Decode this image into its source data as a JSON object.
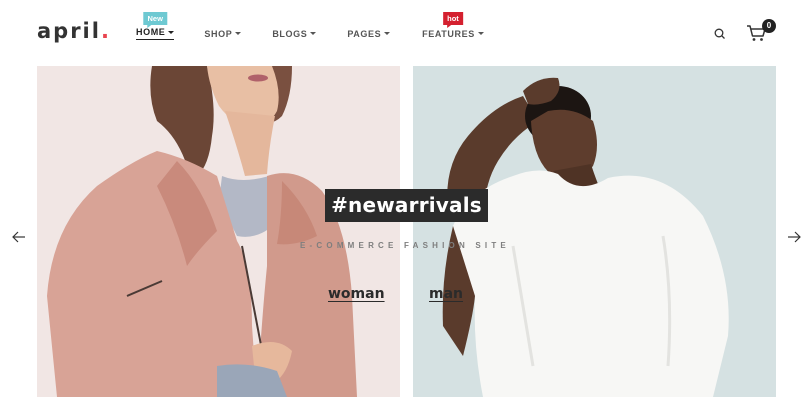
{
  "brand": {
    "name": "april",
    "dot": "."
  },
  "nav": {
    "items": [
      {
        "label": "HOME",
        "badge": "New"
      },
      {
        "label": "SHOP"
      },
      {
        "label": "BLOGS"
      },
      {
        "label": "PAGES"
      },
      {
        "label": "FEATURES",
        "badge": "hot"
      }
    ]
  },
  "header_icons": {
    "search": "search-icon",
    "cart": "cart-icon",
    "cart_count": "0"
  },
  "hero": {
    "tag": "#newarrivals",
    "subtitle": "E-COMMERCE FASHION SITE",
    "links": {
      "woman": "woman",
      "man": "man"
    },
    "arrows": {
      "prev": "arrow-left-icon",
      "next": "arrow-right-icon"
    }
  },
  "colors": {
    "accent": "#e8444f",
    "badge_new": "#6ec9d2",
    "badge_hot": "#d4202f",
    "tag_bg": "#2b2b2b",
    "panel_left": "#f1e6e4",
    "panel_right": "#d5e1e2"
  }
}
